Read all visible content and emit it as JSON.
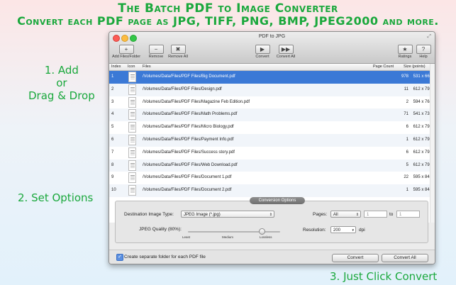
{
  "headline": {
    "line1": "The Batch PDF to Image Converter",
    "line2": "Convert each PDF page as JPG, TIFF, PNG, BMP, JPEG2000 and more."
  },
  "steps": {
    "step1_line1": "1. Add",
    "step1_line2": "or",
    "step1_line3": "Drag & Drop",
    "step2": "2. Set Options",
    "step3": "3. Just Click Convert"
  },
  "window": {
    "title": "PDF to JPG",
    "toolbar": {
      "add_label": "Add Files/Folder",
      "remove_label": "Remove",
      "remove_all_label": "Remove All",
      "convert_label": "Convert",
      "convert_all_label": "Convert All",
      "ratings_label": "Ratings",
      "help_label": "Help",
      "add_glyph": "+",
      "remove_glyph": "−",
      "remove_all_glyph": "✖",
      "convert_glyph": "▶",
      "convert_all_glyph": "▶▶",
      "ratings_glyph": "★",
      "help_glyph": "?"
    },
    "table": {
      "headers": {
        "index": "Index",
        "icon": "Icon",
        "files": "Files",
        "page_count": "Page Count",
        "size": "Size (points)"
      },
      "rows": [
        {
          "index": "1",
          "path": "/Volumes/Data/Files/PDF Files/Big Document.pdf",
          "pages": "978",
          "size": "531 x 666"
        },
        {
          "index": "2",
          "path": "/Volumes/Data/Files/PDF Files/Design.pdf",
          "pages": "11",
          "size": "612 x 792"
        },
        {
          "index": "3",
          "path": "/Volumes/Data/Files/PDF Files/Magazine Feb Edition.pdf",
          "pages": "2",
          "size": "594 x 765"
        },
        {
          "index": "4",
          "path": "/Volumes/Data/Files/PDF Files/Math Problems.pdf",
          "pages": "71",
          "size": "541 x 731"
        },
        {
          "index": "5",
          "path": "/Volumes/Data/Files/PDF Files/Micro Biology.pdf",
          "pages": "6",
          "size": "612 x 792"
        },
        {
          "index": "6",
          "path": "/Volumes/Data/Files/PDF Files/Payment Info.pdf",
          "pages": "1",
          "size": "612 x 792"
        },
        {
          "index": "7",
          "path": "/Volumes/Data/Files/PDF Files/Success story.pdf",
          "pages": "6",
          "size": "612 x 792"
        },
        {
          "index": "8",
          "path": "/Volumes/Data/Files/PDF Files/Web Download.pdf",
          "pages": "5",
          "size": "612 x 792"
        },
        {
          "index": "9",
          "path": "/Volumes/Data/Files/PDF Files/Document 1.pdf",
          "pages": "22",
          "size": "595 x 842"
        },
        {
          "index": "10",
          "path": "/Volumes/Data/Files/PDF Files/Document 2.pdf",
          "pages": "1",
          "size": "595 x 842"
        }
      ]
    },
    "options": {
      "title": "Conversion Options",
      "dest_label": "Destination Image Type:",
      "dest_value": "JPEG Image (*.jpg)",
      "pages_label": "Pages:",
      "pages_value": "All",
      "from_value": "1",
      "to_label": "to",
      "to_value": "1",
      "quality_label": "JPEG Quality (80%):",
      "quality_fraction": 0.8,
      "tick_least": "Least",
      "tick_medium": "Medium",
      "tick_lossless": "Lossless",
      "resolution_label": "Resolution:",
      "resolution_value": "200",
      "resolution_unit": "dpi"
    },
    "bottom": {
      "separate_folder_label": "Create separate folder for each PDF file",
      "separate_folder_checked": true,
      "convert_label": "Convert",
      "convert_all_label": "Convert All"
    }
  }
}
